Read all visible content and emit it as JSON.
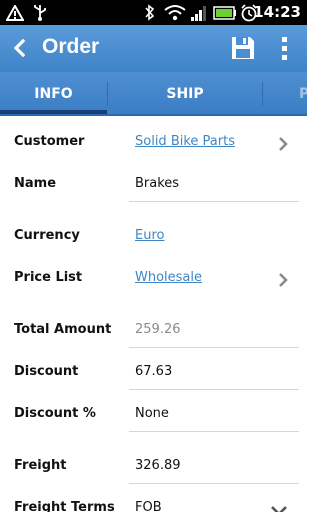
{
  "status_bar": {
    "time": "14:23",
    "icons": [
      "warning-icon",
      "usb-icon",
      "bluetooth-icon",
      "wifi-icon",
      "signal-icon",
      "battery-icon",
      "alarm-icon"
    ]
  },
  "action_bar": {
    "title": "Order",
    "back_icon": "back-icon",
    "save_icon": "save-icon",
    "overflow_icon": "overflow-menu-icon",
    "color": "#4a90d6"
  },
  "tabs": [
    {
      "label": "INFO",
      "selected": true
    },
    {
      "label": "SHIP",
      "selected": false
    },
    {
      "label": "P",
      "selected": false
    }
  ],
  "form": {
    "customer": {
      "label": "Customer",
      "value": "Solid Bike Parts"
    },
    "name": {
      "label": "Name",
      "value": "Brakes"
    },
    "currency": {
      "label": "Currency",
      "value": "Euro"
    },
    "price_list": {
      "label": "Price List",
      "value": "Wholesale"
    },
    "total_amount": {
      "label": "Total Amount",
      "value": "259.26"
    },
    "discount": {
      "label": "Discount",
      "value": "67.63"
    },
    "discount_pct": {
      "label": "Discount %",
      "value": "None"
    },
    "freight": {
      "label": "Freight",
      "value": "326.89"
    },
    "freight_terms": {
      "label": "Freight Terms",
      "value": "FOB"
    }
  },
  "colors": {
    "link": "#3d86c6",
    "accent": "#4a90d6"
  }
}
